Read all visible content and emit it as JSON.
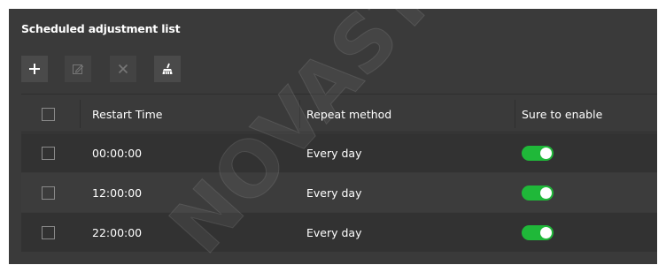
{
  "panel": {
    "title": "Scheduled adjustment list"
  },
  "toolbar": {
    "add_icon": "plus-icon",
    "edit_icon": "edit-icon",
    "delete_icon": "close-icon",
    "clear_icon": "broom-icon"
  },
  "table": {
    "headers": {
      "restart_time": "Restart Time",
      "repeat_method": "Repeat method",
      "sure_to_enable": "Sure to enable"
    },
    "rows": [
      {
        "time": "00:00:00",
        "repeat": "Every day",
        "enabled": true
      },
      {
        "time": "12:00:00",
        "repeat": "Every day",
        "enabled": true
      },
      {
        "time": "22:00:00",
        "repeat": "Every day",
        "enabled": true
      }
    ]
  },
  "colors": {
    "panel_bg": "#3a3a3a",
    "toggle_on": "#1fb839"
  },
  "watermark": "NOVASTAR"
}
